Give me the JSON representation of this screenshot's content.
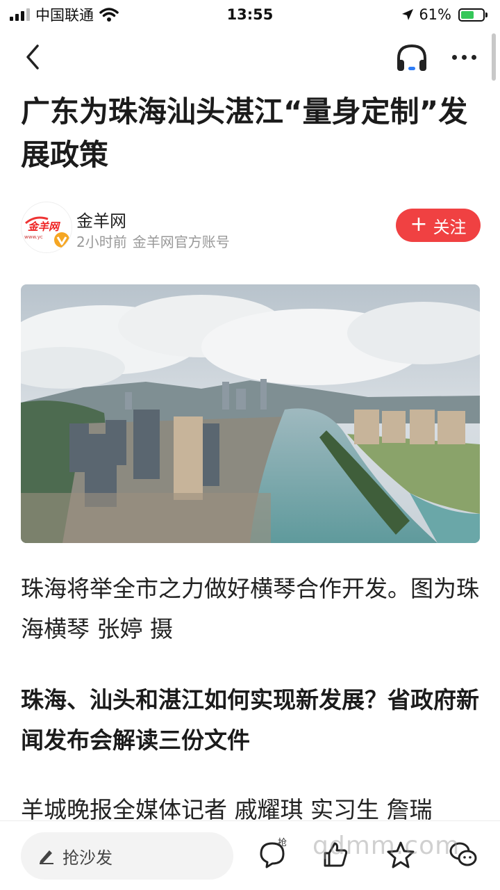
{
  "status_bar": {
    "carrier": "中国联通",
    "time": "13:55",
    "battery_percent": "61%",
    "battery_level": 0.61
  },
  "nav": {
    "back_icon": "chevron-left-icon",
    "listen_icon": "headphones-icon",
    "more_icon": "more-dots-icon"
  },
  "article": {
    "title": "广东为珠海汕头湛江“量身定制”发展政策",
    "author": {
      "name": "金羊网",
      "time": "2小时前",
      "account": "金羊网官方账号",
      "logo_text": "金羊网",
      "follow_label": "关注"
    },
    "caption": "珠海将举全市之力做好横琴合作开发。图为珠海横琴 张婷 摄",
    "subhead": "珠海、汕头和湛江如何实现新发展？省政府新闻发布会解读三份文件",
    "body_start": "羊城晚报全媒体记者 戚耀琪 实习生 詹瑞"
  },
  "bottom_bar": {
    "comment_placeholder": "抢沙发",
    "comment_badge": "抢",
    "watermark": "qdmm.com"
  },
  "colors": {
    "accent": "#f04142",
    "text": "#222222",
    "meta": "#999999"
  }
}
